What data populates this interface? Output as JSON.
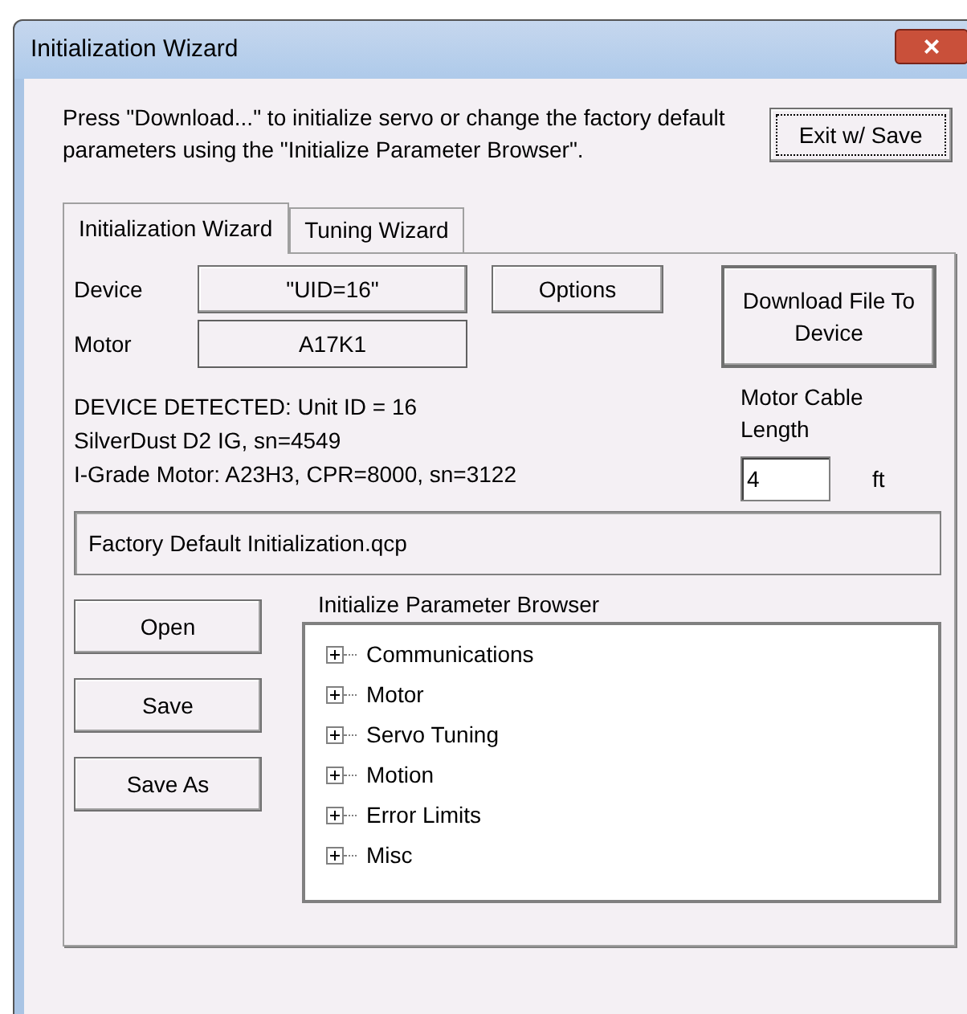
{
  "window": {
    "title": "Initialization Wizard",
    "close": "×"
  },
  "intro": "Press \"Download...\" to initialize servo or change the factory default parameters using the \"Initialize Parameter Browser\".",
  "exit_button": "Exit w/ Save",
  "tabs": [
    {
      "label": "Initialization Wizard",
      "selected": true
    },
    {
      "label": "Tuning Wizard",
      "selected": false
    }
  ],
  "device": {
    "label": "Device",
    "value": "\"UID=16\""
  },
  "options_button": "Options",
  "motor": {
    "label": "Motor",
    "value": "A17K1"
  },
  "download_button": "Download File To Device",
  "detected": [
    "DEVICE DETECTED: Unit ID = 16",
    "SilverDust D2 IG, sn=4549",
    "I-Grade Motor: A23H3, CPR=8000, sn=3122"
  ],
  "cable": {
    "label": "Motor Cable Length",
    "value": "4",
    "unit": "ft"
  },
  "file_path": "Factory Default Initialization.qcp",
  "file_buttons": [
    "Open",
    "Save",
    "Save As"
  ],
  "browser": {
    "label": "Initialize Parameter Browser",
    "items": [
      {
        "label": "Communications",
        "expanded": false
      },
      {
        "label": "Motor",
        "expanded": false
      },
      {
        "label": "Servo Tuning",
        "expanded": false
      },
      {
        "label": "Motion",
        "expanded": false
      },
      {
        "label": "Error Limits",
        "expanded": false
      },
      {
        "label": "Misc",
        "expanded": false
      }
    ]
  }
}
